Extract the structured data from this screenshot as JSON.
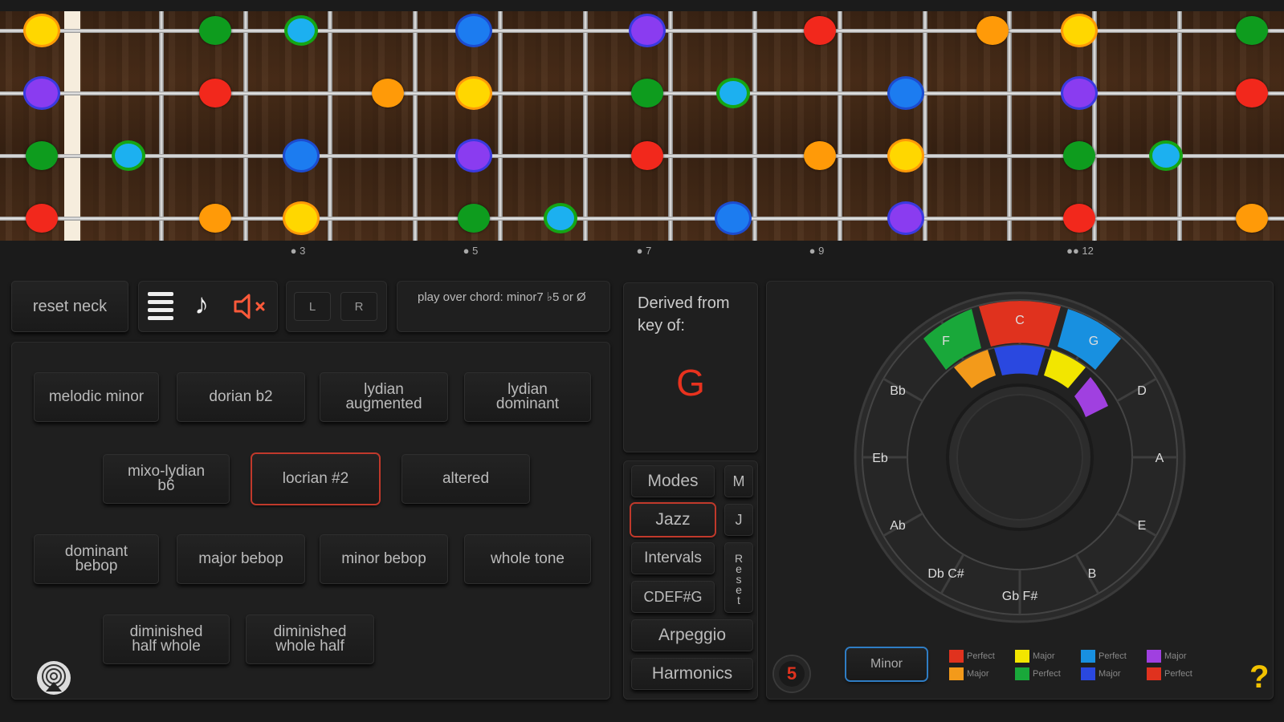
{
  "fretboard": {
    "markers": [
      "3",
      "5",
      "7",
      "9",
      "12"
    ]
  },
  "controls": {
    "reset_neck": "reset neck",
    "left_label": "L",
    "right_label": "R",
    "chord_hint": "play over chord: minor7 ♭5 or Ø"
  },
  "scales": [
    {
      "label": "melodic minor"
    },
    {
      "label": "dorian b2"
    },
    {
      "label": "lydian augmented"
    },
    {
      "label": "lydian dominant"
    },
    {
      "label": "mixo-lydian b6"
    },
    {
      "label": "locrian #2",
      "selected": true
    },
    {
      "label": "altered"
    },
    {
      "label": "dominant bebop"
    },
    {
      "label": "major bebop"
    },
    {
      "label": "minor bebop"
    },
    {
      "label": "whole tone"
    },
    {
      "label": "diminished half whole"
    },
    {
      "label": "diminished whole half"
    }
  ],
  "derived": {
    "label": "Derived from key of:",
    "key": "G"
  },
  "modes_panel": {
    "modes": "Modes",
    "m": "M",
    "jazz": "Jazz",
    "j": "J",
    "intervals": "Intervals",
    "reset": "Reset",
    "cdefg": "CDEF#G",
    "arpeggio": "Arpeggio",
    "harmonics": "Harmonics"
  },
  "circle": {
    "outer_keys": [
      "C",
      "G",
      "D",
      "A",
      "E",
      "B",
      "Gb F#",
      "Db C#",
      "Ab",
      "Eb",
      "Bb",
      "F"
    ],
    "minor_button": "Minor",
    "badge": "5",
    "help": "?"
  },
  "legend": [
    {
      "text": "Perfect",
      "color": "#e0321e"
    },
    {
      "text": "Major",
      "color": "#f39a1a"
    },
    {
      "text": "Major",
      "color": "#f2e600"
    },
    {
      "text": "Perfect",
      "color": "#19a83a"
    },
    {
      "text": "Perfect",
      "color": "#1890e0"
    },
    {
      "text": "Major",
      "color": "#2a48e0"
    },
    {
      "text": "Major",
      "color": "#a040e0"
    },
    {
      "text": "Perfect",
      "color": "#e0321e"
    }
  ],
  "colors": {
    "red": "#f2281c",
    "orange": "#ff9a08",
    "yellow": "#ffd700",
    "green": "#0e9c1e",
    "cyan": "#1cb0f0",
    "blue": "#1c6cf0",
    "purple": "#8a3cf0",
    "accent_red": "#c0392b",
    "accent_blue": "#2f7dc4"
  }
}
